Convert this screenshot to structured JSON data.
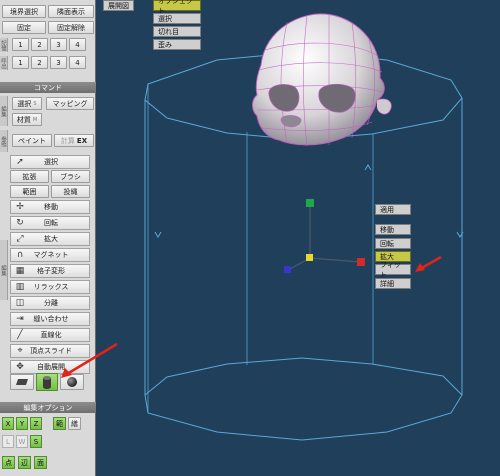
{
  "left_panel": {
    "top_rows": [
      {
        "left": "境界選択",
        "right": "隣面表示"
      },
      {
        "left": "固定",
        "right": "固定解除"
      }
    ],
    "memory_row": {
      "tab": "記憶",
      "buttons": [
        "1",
        "2",
        "3",
        "4"
      ]
    },
    "recall_row": {
      "tab": "呼出",
      "buttons": [
        "1",
        "2",
        "3",
        "4"
      ]
    },
    "command_title": "コマンド",
    "side_tab_1": "編集",
    "side_tab_2": "参照",
    "side_tab_3": "編集",
    "select_btn": "選択",
    "select_badge": "S",
    "mapping_btn": "マッピング",
    "material_btn": "材質",
    "material_badge": "M",
    "paint_btn": "ペイント",
    "measure_btn": "計算",
    "ex_badge": "EX",
    "commands": [
      {
        "icon": "pointer-icon",
        "glyph": "➚",
        "label": "選択"
      },
      {
        "pair": [
          "拡張",
          "ブラシ"
        ]
      },
      {
        "pair": [
          "範囲",
          "投縄"
        ]
      },
      {
        "icon": "move-icon",
        "glyph": "✢",
        "label": "移動"
      },
      {
        "icon": "rotate-icon",
        "glyph": "↻",
        "label": "回転"
      },
      {
        "icon": "scale-icon",
        "glyph": "⤢",
        "label": "拡大"
      },
      {
        "icon": "magnet-icon",
        "glyph": "∩",
        "label": "マグネット"
      },
      {
        "icon": "lattice-icon",
        "glyph": "▦",
        "label": "格子変形"
      },
      {
        "icon": "relax-icon",
        "glyph": "▥",
        "label": "リラックス"
      },
      {
        "icon": "split-icon",
        "glyph": "◫",
        "label": "分離"
      },
      {
        "icon": "weld-icon",
        "glyph": "⇥",
        "label": "縫い合わせ"
      },
      {
        "icon": "straighten-icon",
        "glyph": "╱",
        "label": "直線化"
      },
      {
        "icon": "vertex-slide-icon",
        "glyph": "⌖",
        "label": "頂点スライド"
      },
      {
        "icon": "auto-unwrap-icon",
        "glyph": "✥",
        "label": "自動展開"
      }
    ],
    "projection_icons": [
      "plane-projection-icon",
      "cylinder-projection-icon",
      "sphere-projection-icon"
    ],
    "edit_options_title": "編集オプション",
    "axis_buttons": [
      "X",
      "Y",
      "Z",
      "範",
      "繕"
    ],
    "row_lws": [
      "L",
      "W",
      "S"
    ],
    "bottom_buttons": [
      "点",
      "辺",
      "面"
    ]
  },
  "viewport": {
    "top_left_btn": "展開図",
    "mode_buttons": [
      {
        "label": "オブジェクト",
        "active": true
      },
      {
        "label": "選択",
        "active": false
      },
      {
        "label": "切れ目",
        "active": false
      },
      {
        "label": "歪み",
        "active": false
      }
    ],
    "context_menu": [
      {
        "label": "適用",
        "active": false
      },
      {
        "label": "移動",
        "active": false
      },
      {
        "label": "回転",
        "active": false
      },
      {
        "label": "拡大",
        "active": true
      },
      {
        "label": "フィット",
        "active": false
      },
      {
        "label": "詳細",
        "active": false
      }
    ],
    "colors": {
      "bg": "#1f3f5a",
      "cylinder": "#5aa9d8",
      "mesh_wire": "#c05fc0",
      "axis_x": "#d22b2b",
      "axis_y": "#1fa84a",
      "axis_z": "#3737d0",
      "center": "#e8d82b",
      "arrow": "#e2231a"
    }
  }
}
